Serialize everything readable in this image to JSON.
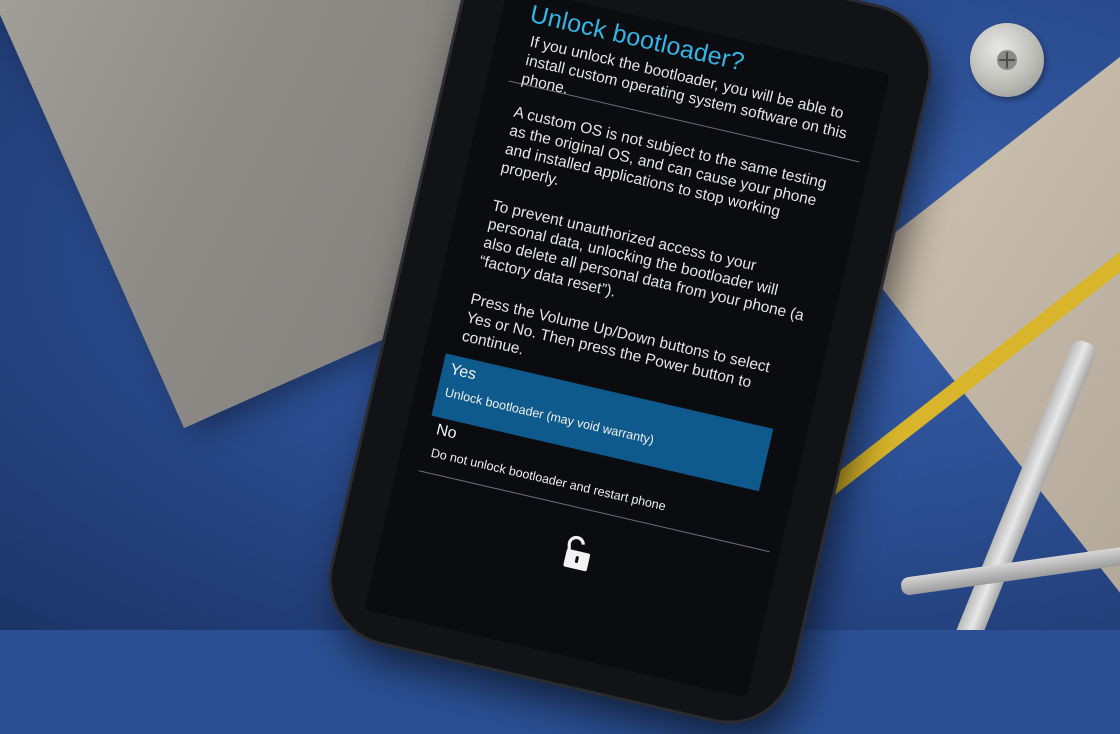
{
  "bootloader": {
    "title": "Unlock bootloader?",
    "paragraphs": [
      "If you unlock the bootloader, you will be able to install custom operating system software on this phone.",
      "A custom OS is not subject to the same testing as the original OS, and can cause your phone and installed applications to stop working properly.",
      "To prevent unauthorized access to your personal data, unlocking the bootloader will also delete all personal data from your phone (a “factory data reset”).",
      "Press the Volume Up/Down buttons to select Yes or No. Then press the Power button to continue."
    ],
    "options": [
      {
        "label": "Yes",
        "description": "Unlock bootloader (may void warranty)",
        "selected": true
      },
      {
        "label": "No",
        "description": "Do not unlock bootloader and restart phone",
        "selected": false
      }
    ],
    "footer_icon": "unlocked-padlock-icon"
  },
  "colors": {
    "title": "#33b5e5",
    "selected_option": "#0f5a8d",
    "screen_background": "#0b0c10",
    "body_text": "#e6e6e6"
  }
}
